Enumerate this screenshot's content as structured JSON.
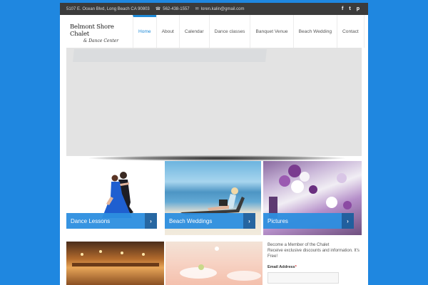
{
  "topbar": {
    "address": "5107 E. Ocean Blvd, Long Beach CA 90803",
    "phone": "562-438-1557",
    "email": "loren.kalin@gmail.com",
    "social": [
      "f",
      "t",
      "p"
    ]
  },
  "logo": {
    "line1": "Belmont Shore Chalet",
    "line2": "& Dance Center"
  },
  "nav": [
    "Home",
    "About",
    "Calendar",
    "Dance classes",
    "Banquet Venue",
    "Beach Wedding",
    "Contact"
  ],
  "tiles": [
    {
      "label": "Dance Lessons"
    },
    {
      "label": "Beach Weddings"
    },
    {
      "label": "Pictures"
    }
  ],
  "member": {
    "line1": "Become a Member of the Chalet",
    "line2": "Receive exclusive discounts and information. It's Free!",
    "email_label": "Email Address",
    "required_mark": "*"
  },
  "colors": {
    "background": "#1f87e0",
    "accent": "#1d8ad8",
    "caption": "#2d8fe0",
    "topbar": "#3b3b3b"
  }
}
